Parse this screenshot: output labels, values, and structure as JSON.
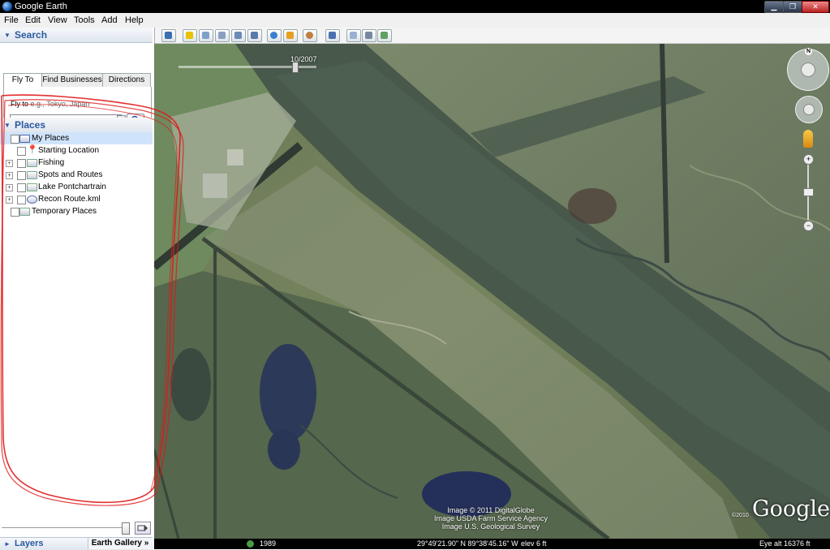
{
  "window": {
    "title": "Google Earth",
    "minimize": "▁",
    "maximize": "❐",
    "close": "✕"
  },
  "menu": [
    "File",
    "Edit",
    "View",
    "Tools",
    "Add",
    "Help"
  ],
  "search": {
    "header": "Search",
    "tabs": [
      "Fly To",
      "Find Businesses",
      "Directions"
    ],
    "fly_to_label": "Fly to",
    "fly_to_placeholder": "e.g., Tokyo, Japan",
    "fly_to_value": ""
  },
  "places": {
    "header": "Places",
    "items": [
      {
        "label": "My Places",
        "selected": true
      },
      {
        "label": "Starting Location"
      },
      {
        "label": "Fishing"
      },
      {
        "label": "Spots and Routes"
      },
      {
        "label": "Lake Pontchartrain"
      },
      {
        "label": "Recon Route.kml"
      },
      {
        "label": "Temporary Places"
      }
    ]
  },
  "layers": {
    "header": "Layers",
    "gallery": "Earth Gallery »"
  },
  "map": {
    "time_label": "10/2007",
    "year": "1989",
    "credits": [
      "Image © 2011 DigitalGlobe",
      "Image USDA Farm Service Agency",
      "Image U.S. Geological Survey"
    ],
    "copyright_year": "©2010",
    "logo": "Google",
    "compass_north": "N"
  },
  "status": {
    "coords": "29°49'21.90\" N   89°38'45.16\" W",
    "elev": "elev    6 ft",
    "eye_alt": "Eye alt   16376 ft"
  }
}
